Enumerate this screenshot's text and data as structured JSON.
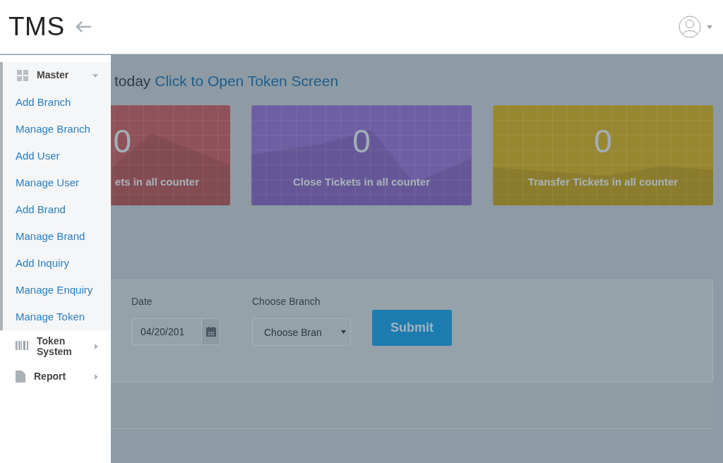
{
  "header": {
    "logo": "TMS"
  },
  "heading": {
    "text": "today",
    "link": "Click to Open Token Screen"
  },
  "cards": [
    {
      "kind": "partial",
      "value": "0",
      "label": "ets in all counter",
      "color": "#8f525a"
    },
    {
      "kind": "full",
      "value": "0",
      "label": "Close Tickets in all counter",
      "color": "#6e5fa4"
    },
    {
      "kind": "full",
      "value": "0",
      "label": "Transfer Tickets in all counter",
      "color": "#978731"
    }
  ],
  "form": {
    "date_label": "Date",
    "date_value": "04/20/201",
    "branch_label": "Choose Branch",
    "branch_value": "Choose Bran",
    "submit": "Submit"
  },
  "sidebar": {
    "items": [
      {
        "label": "Master",
        "expanded": true,
        "children": [
          {
            "label": "Add Branch"
          },
          {
            "label": "Manage Branch"
          },
          {
            "label": "Add User"
          },
          {
            "label": "Manage User"
          },
          {
            "label": "Add Brand"
          },
          {
            "label": "Manage Brand"
          },
          {
            "label": "Add Inquiry"
          },
          {
            "label": "Manage Enquiry"
          },
          {
            "label": "Manage Token"
          }
        ]
      },
      {
        "label": "Token System",
        "expanded": false
      },
      {
        "label": "Report",
        "expanded": false
      }
    ]
  }
}
